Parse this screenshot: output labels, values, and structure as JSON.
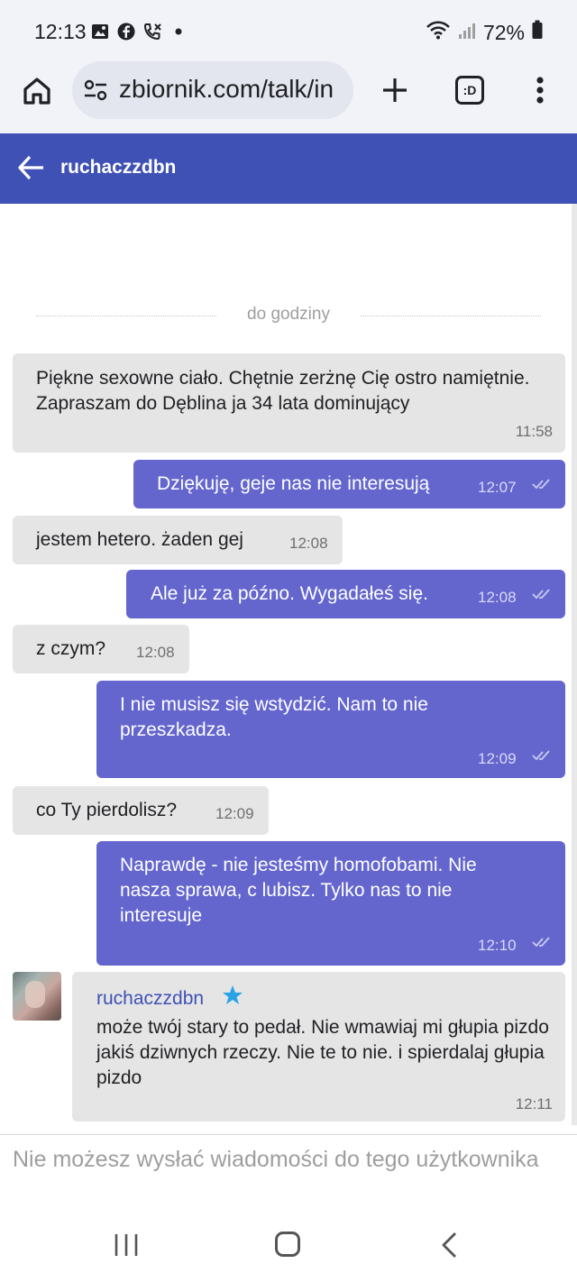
{
  "status_bar": {
    "time": "12:13",
    "battery": "72%",
    "icons": [
      "gallery-icon",
      "facebook-icon",
      "call-icon",
      "dot-icon",
      "wifi-icon",
      "signal-icon",
      "battery-icon"
    ]
  },
  "browser": {
    "url": "zbiornik.com/talk/in",
    "tabs_badge": ":D"
  },
  "header": {
    "title": "ruchaczzdbn"
  },
  "chat": {
    "divider_label": "do godziny",
    "messages": [
      {
        "direction": "in",
        "text": "Piękne sexowne ciało. Chętnie zerżnę Cię ostro namiętnie. Zapraszam do Dęblina ja 34 lata dominujący",
        "time": "11:58"
      },
      {
        "direction": "out",
        "text": "Dziękuję, geje nas nie interesują",
        "time": "12:07"
      },
      {
        "direction": "in",
        "text": "jestem hetero. żaden gej",
        "time": "12:08"
      },
      {
        "direction": "out",
        "text": "Ale już za późno. Wygadałeś się.",
        "time": "12:08"
      },
      {
        "direction": "in",
        "text": "z czym?",
        "time": "12:08"
      },
      {
        "direction": "out",
        "text": "I nie musisz się wstydzić. Nam to nie przeszkadza.",
        "time": "12:09"
      },
      {
        "direction": "in",
        "text": "co Ty pierdolisz?",
        "time": "12:09"
      },
      {
        "direction": "out",
        "text": "Naprawdę - nie jesteśmy homofobami. Nie nasza sprawa, c lubisz. Tylko nas to nie interesuje",
        "time": "12:10"
      },
      {
        "direction": "in",
        "sender": "ruchaczzdbn",
        "text": "może twój stary to pedał. Nie wmawiaj mi głupia pizdo jakiś dziwnych rzeczy. Nie te to nie. i spierdalaj głupia pizdo",
        "time": "12:11"
      }
    ]
  },
  "footer": {
    "note": "Nie możesz wysłać wiadomości do tego użytkownika"
  },
  "colors": {
    "header": "#3f51b5",
    "outgoing_bubble": "#6466ce",
    "incoming_bubble": "#e5e5e5",
    "star": "#29a3e8"
  }
}
